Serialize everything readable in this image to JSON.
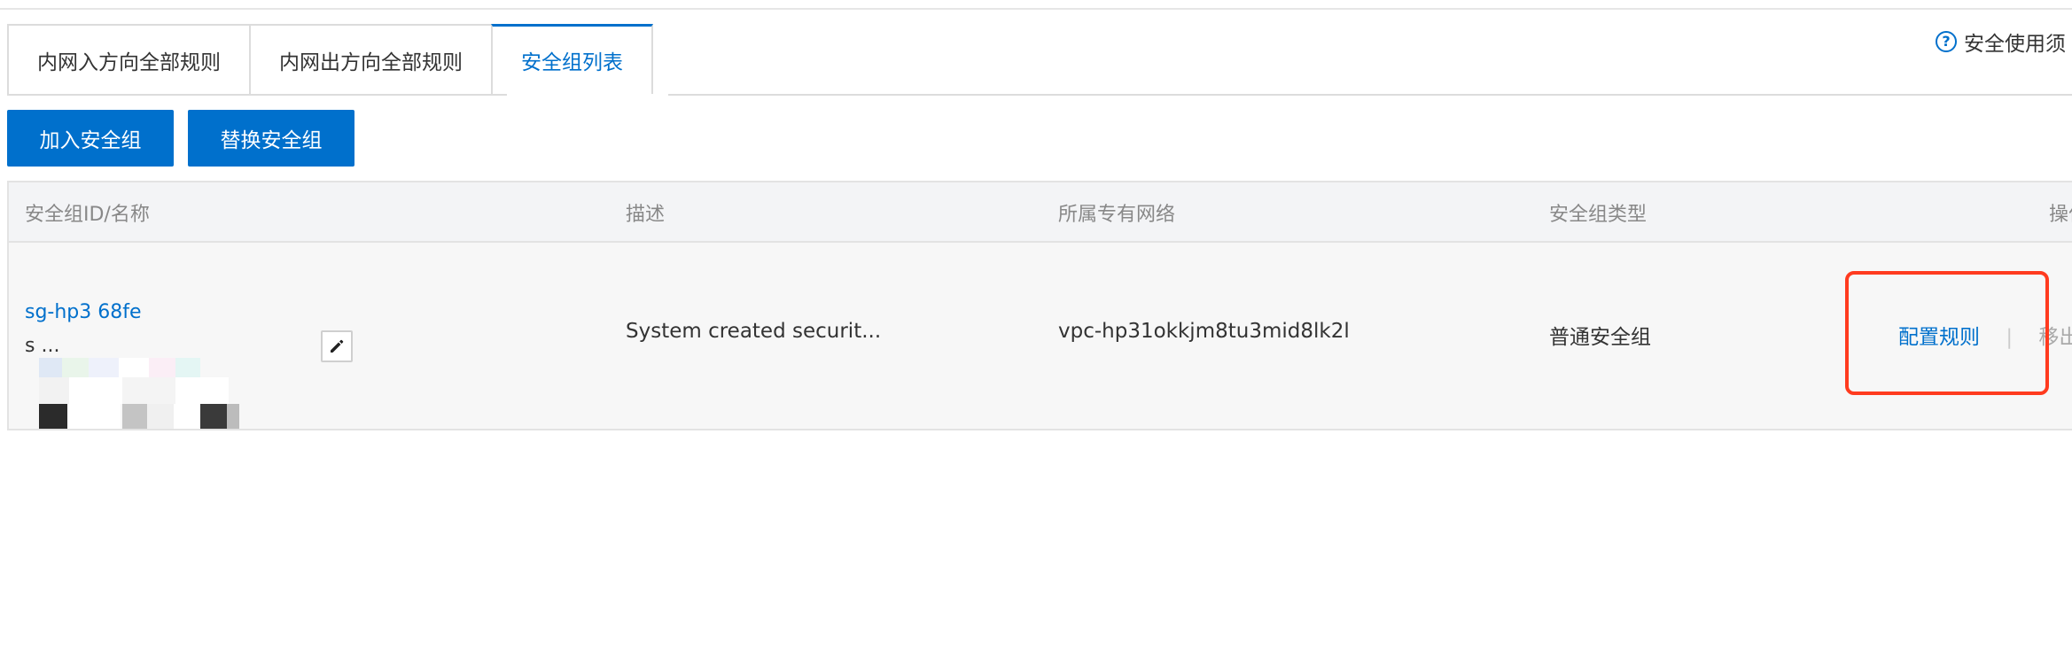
{
  "tabs": [
    {
      "label": "内网入方向全部规则",
      "active": false
    },
    {
      "label": "内网出方向全部规则",
      "active": false
    },
    {
      "label": "安全组列表",
      "active": true
    }
  ],
  "help": {
    "label": "安全使用须",
    "icon": "help-circle-icon"
  },
  "buttons": {
    "join": "加入安全组",
    "replace": "替换安全组"
  },
  "table": {
    "headers": {
      "id_name": "安全组ID/名称",
      "description": "描述",
      "vpc": "所属专有网络",
      "type": "安全组类型",
      "actions": "操作"
    },
    "rows": [
      {
        "id": "sg-hp3                68fe",
        "name": "s                          ...",
        "description": "System created securit...",
        "vpc": "vpc-hp31okkjm8tu3mid8lk2l",
        "type": "普通安全组",
        "configure": "配置规则",
        "separator": "|",
        "remove": "移出"
      }
    ]
  },
  "colors": {
    "accent": "#0070cc",
    "highlight": "#ff3b1f"
  }
}
